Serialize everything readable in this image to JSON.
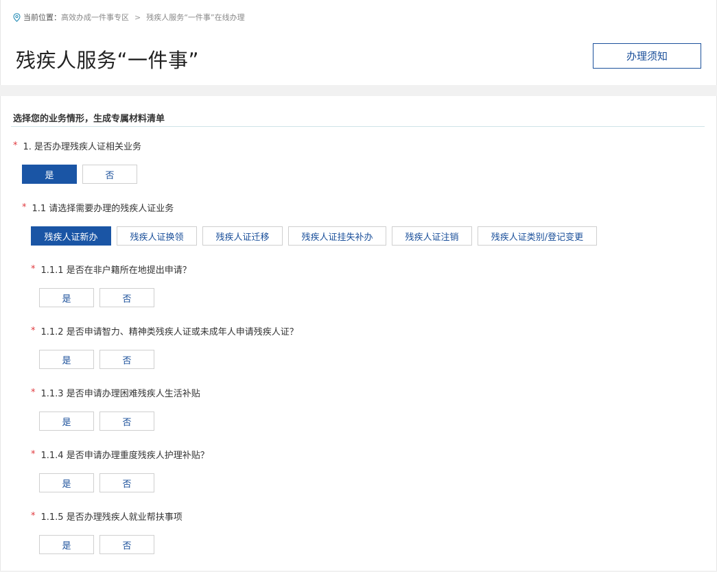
{
  "breadcrumb": {
    "label": "当前位置：",
    "items": [
      "高效办成一件事专区",
      "残疾人服务“一件事”在线办理"
    ],
    "separator": ">"
  },
  "page": {
    "title": "残疾人服务“一件事”",
    "notice_button": "办理须知"
  },
  "section": {
    "title": "选择您的业务情形，生成专属材料清单"
  },
  "colors": {
    "primary": "#1a55a5",
    "required_star": "#e0393e",
    "divider": "#cfe3e8"
  },
  "required_mark": "*",
  "q1": {
    "label": "1. 是否办理残疾人证相关业务",
    "yes": "是",
    "no": "否",
    "selected": "是"
  },
  "q1_1": {
    "label": "1.1 请选择需要办理的残疾人证业务",
    "options": [
      "残疾人证新办",
      "残疾人证换领",
      "残疾人证迁移",
      "残疾人证挂失补办",
      "残疾人证注销",
      "残疾人证类别/登记变更"
    ],
    "selected": "残疾人证新办"
  },
  "sub_questions": [
    {
      "label": "1.1.1 是否在非户籍所在地提出申请？",
      "yes": "是",
      "no": "否"
    },
    {
      "label": "1.1.2 是否申请智力、精神类残疾人证或未成年人申请残疾人证？",
      "yes": "是",
      "no": "否"
    },
    {
      "label": "1.1.3 是否申请办理困难残疾人生活补贴",
      "yes": "是",
      "no": "否"
    },
    {
      "label": "1.1.4 是否申请办理重度残疾人护理补贴？",
      "yes": "是",
      "no": "否"
    },
    {
      "label": "1.1.5 是否办理残疾人就业帮扶事项",
      "yes": "是",
      "no": "否"
    }
  ]
}
